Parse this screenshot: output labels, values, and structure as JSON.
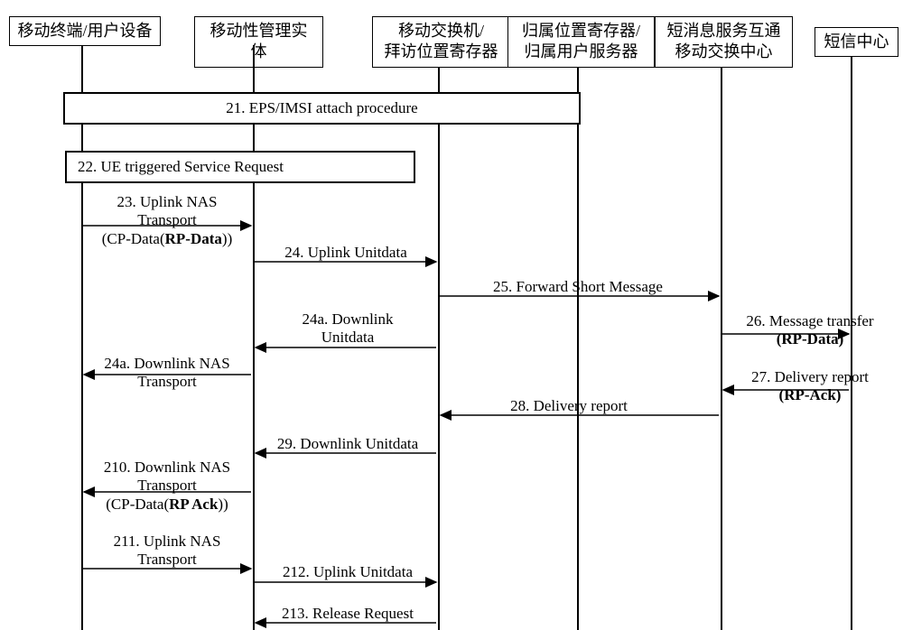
{
  "participants": {
    "ue": "移动终端/用户设备",
    "mme": "移动性管理实体",
    "msc_vlr_l1": "移动交换机/",
    "msc_vlr_l2": "拜访位置寄存器",
    "hlr_hss_l1": "归属位置寄存器/",
    "hlr_hss_l2": "归属用户服务器",
    "smsiw_l1": "短消息服务互通",
    "smsiw_l2": "移动交换中心",
    "smsc": "短信中心"
  },
  "messages": {
    "m21": "21. EPS/IMSI attach procedure",
    "m22": "22. UE triggered Service Request",
    "m23_l1": "23. Uplink NAS",
    "m23_l2": "Transport",
    "m23_l3": "(CP-Data(",
    "m23_l3b": "RP-Data",
    "m23_l3c": "))",
    "m24": "24. Uplink Unitdata",
    "m25": "25. Forward Short Message",
    "m26_l1": "26. Message transfer",
    "m26_l2": "(RP-Data)",
    "m24a_l1": "24a. Downlink",
    "m24a_l2": "Unitdata",
    "m24an_l1": "24a. Downlink NAS",
    "m24an_l2": "Transport",
    "m27_l1": "27. Delivery report",
    "m27_l2": "(RP-Ack)",
    "m28": "28. Delivery report",
    "m29": "29. Downlink Unitdata",
    "m210_l1": "210. Downlink NAS",
    "m210_l2": "Transport",
    "m210_l3a": "(CP-Data(",
    "m210_l3b": "RP Ack",
    "m210_l3c": "))",
    "m211_l1": "211. Uplink NAS",
    "m211_l2": "Transport",
    "m212": "212. Uplink Unitdata",
    "m213": "213. Release Request"
  }
}
